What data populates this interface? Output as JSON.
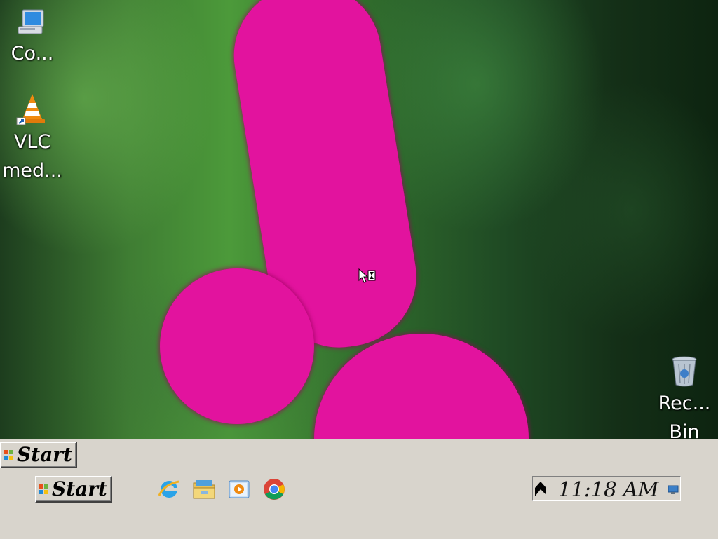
{
  "desktop": {
    "icons": [
      {
        "label": "Co...",
        "icon": "computer-icon"
      },
      {
        "label_line1": "VLC",
        "label_line2": "med...",
        "icon": "vlc-icon"
      },
      {
        "label_line1": "Rec...",
        "label_line2": "Bin",
        "icon": "recycle-bin-icon"
      }
    ]
  },
  "taskbar": {
    "start_top_label": "Start",
    "start_label": "Start",
    "quick_launch": [
      {
        "icon": "internet-explorer-icon"
      },
      {
        "icon": "file-explorer-icon"
      },
      {
        "icon": "media-player-icon"
      },
      {
        "icon": "chrome-icon"
      }
    ],
    "tray": {
      "clock": "11:18 AM",
      "icons": [
        "action-center-flag-icon",
        "network-icon"
      ]
    }
  },
  "colors": {
    "taskbar": "#d8d4cc",
    "foreground_shape": "#e2139e",
    "desktop_green": "#3f7d33"
  }
}
